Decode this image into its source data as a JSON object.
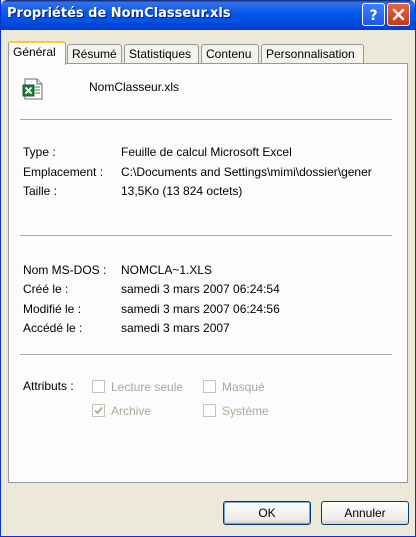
{
  "window": {
    "title": "Propriétés de NomClasseur.xls"
  },
  "titlebar_buttons": {
    "help": "help-icon",
    "close": "close-icon"
  },
  "tabs": [
    {
      "label": "Général",
      "active": true
    },
    {
      "label": "Résumé",
      "active": false
    },
    {
      "label": "Statistiques",
      "active": false
    },
    {
      "label": "Contenu",
      "active": false
    },
    {
      "label": "Personnalisation",
      "active": false
    }
  ],
  "file": {
    "name": "NomClasseur.xls",
    "icon": "excel-file-icon"
  },
  "info": {
    "type_label": "Type :",
    "type_value": "Feuille de calcul Microsoft Excel",
    "location_label": "Emplacement :",
    "location_value": "C:\\Documents and Settings\\mimi\\dossier\\gener",
    "size_label": "Taille :",
    "size_value": "13,5Ko (13 824 octets)"
  },
  "dates": {
    "msdos_label": "Nom MS-DOS :",
    "msdos_value": "NOMCLA~1.XLS",
    "created_label": "Créé le :",
    "created_value": "samedi 3 mars 2007 06:24:54",
    "modified_label": "Modifié le :",
    "modified_value": "samedi 3 mars 2007 06:24:56",
    "accessed_label": "Accédé le :",
    "accessed_value": "samedi 3 mars 2007"
  },
  "attributes": {
    "label": "Attributs :",
    "readonly": {
      "label": "Lecture seule",
      "checked": false
    },
    "hidden": {
      "label": "Masqué",
      "checked": false
    },
    "archive": {
      "label": "Archive",
      "checked": true
    },
    "system": {
      "label": "Système",
      "checked": false
    }
  },
  "buttons": {
    "ok": "OK",
    "cancel": "Annuler"
  },
  "colors": {
    "titlebar": "#0058ee",
    "background": "#ece9d8",
    "tab_highlight": "#ffc83c",
    "disabled_text": "#aca899"
  }
}
